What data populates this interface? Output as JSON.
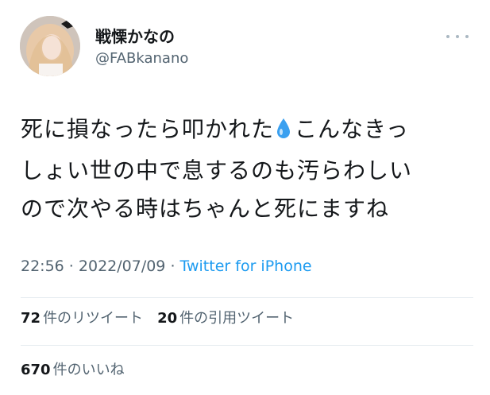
{
  "user": {
    "display_name": "戦慄かなの",
    "handle": "@FABkanano"
  },
  "tweet": {
    "line1_a": "死に損なったら叩かれた",
    "line1_icon": "droplet-icon",
    "line1_b": "こんなきっ",
    "line2": "しょい世の中で息するのも汚らわしい",
    "line3": "ので次やる時はちゃんと死にますね"
  },
  "meta": {
    "time": "22:56",
    "sep1": " · ",
    "date": "2022/07/09",
    "sep2": " · ",
    "source": "Twitter for iPhone"
  },
  "stats": {
    "retweets_count": "72",
    "retweets_label": "件のリツイート",
    "quotes_count": "20",
    "quotes_label": "件の引用ツイート",
    "likes_count": "670",
    "likes_label": "件のいいね"
  },
  "colors": {
    "link": "#1d9bf0",
    "secondary_text": "#536471",
    "droplet": "#3aa0f0"
  }
}
